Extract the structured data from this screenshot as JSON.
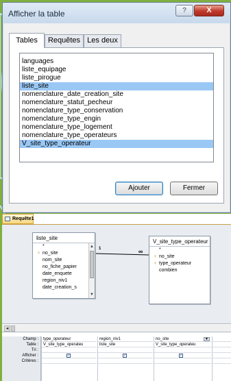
{
  "dialog": {
    "title": "Afficher la table",
    "help_label": "?",
    "close_label": "X",
    "tabs": [
      {
        "label": "Tables",
        "active": true
      },
      {
        "label": "Requêtes",
        "active": false
      },
      {
        "label": "Les deux",
        "active": false
      }
    ],
    "tables_list": [
      {
        "label": "languages",
        "selected": false
      },
      {
        "label": "liste_equipage",
        "selected": false
      },
      {
        "label": "liste_pirogue",
        "selected": false
      },
      {
        "label": "liste_site",
        "selected": true
      },
      {
        "label": "nomenclature_date_creation_site",
        "selected": false
      },
      {
        "label": "nomenclature_statut_pecheur",
        "selected": false
      },
      {
        "label": "nomenclature_type_conservation",
        "selected": false
      },
      {
        "label": "nomenclature_type_engin",
        "selected": false
      },
      {
        "label": "nomenclature_type_logement",
        "selected": false
      },
      {
        "label": "nomenclature_type_operateurs",
        "selected": false
      },
      {
        "label": "V_site_type_operateur",
        "selected": true
      }
    ],
    "add_button": "Ajouter",
    "close_button": "Fermer"
  },
  "query": {
    "tab_label": "Requête1",
    "relationship": {
      "one_label": "1",
      "many_label": "∞"
    },
    "tables": [
      {
        "name": "liste_site",
        "fields": [
          {
            "label": "*",
            "key": false
          },
          {
            "label": "no_site",
            "key": true
          },
          {
            "label": "nom_site",
            "key": false
          },
          {
            "label": "no_fiche_papier",
            "key": false
          },
          {
            "label": "date_enquete",
            "key": false
          },
          {
            "label": "region_niv1",
            "key": false
          },
          {
            "label": "date_creation_s",
            "key": false
          }
        ]
      },
      {
        "name": "V_site_type_operateur",
        "fields": [
          {
            "label": "*",
            "key": false
          },
          {
            "label": "no_site",
            "key": true
          },
          {
            "label": "type_operateur",
            "key": true
          },
          {
            "label": "combien",
            "key": false
          }
        ]
      }
    ],
    "grid": {
      "row_labels": [
        "Champ :",
        "Table :",
        "Tri :",
        "Afficher :",
        "Critères :"
      ],
      "columns": [
        {
          "field": "type_operateur",
          "table": "V_site_type_operateu",
          "show": true
        },
        {
          "field": "region_niv1",
          "table": "liste_site",
          "show": true
        },
        {
          "field": "no_site",
          "table": "V_site_type_operateu",
          "show": true
        }
      ]
    },
    "checkmark": "✓"
  },
  "colors": {
    "background": "#7fb040",
    "selection": "#99c8f5",
    "close_red": "#c0392b"
  }
}
